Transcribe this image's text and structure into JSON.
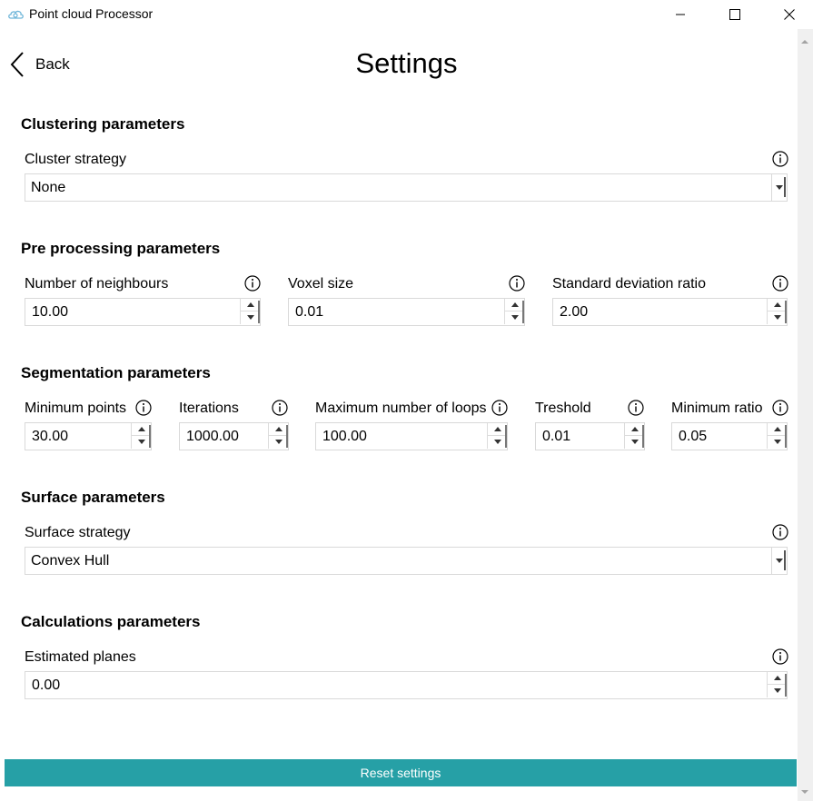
{
  "window": {
    "title": "Point cloud Processor",
    "icon": "cloud-icon"
  },
  "header": {
    "back_label": "Back",
    "page_title": "Settings"
  },
  "clustering": {
    "title": "Clustering parameters",
    "cluster_strategy_label": "Cluster strategy",
    "cluster_strategy_value": "None"
  },
  "preprocessing": {
    "title": "Pre processing parameters",
    "neighbours_label": "Number of neighbours",
    "neighbours_value": "10.00",
    "voxel_label": "Voxel size",
    "voxel_value": "0.01",
    "std_ratio_label": "Standard deviation ratio",
    "std_ratio_value": "2.00"
  },
  "segmentation": {
    "title": "Segmentation parameters",
    "min_points_label": "Minimum points",
    "min_points_value": "30.00",
    "iterations_label": "Iterations",
    "iterations_value": "1000.00",
    "max_loops_label": "Maximum number of loops",
    "max_loops_value": "100.00",
    "threshold_label": "Treshold",
    "threshold_value": "0.01",
    "min_ratio_label": "Minimum ratio",
    "min_ratio_value": "0.05"
  },
  "surface": {
    "title": "Surface parameters",
    "strategy_label": "Surface strategy",
    "strategy_value": "Convex Hull"
  },
  "calculations": {
    "title": "Calculations parameters",
    "planes_label": "Estimated planes",
    "planes_value": "0.00"
  },
  "footer": {
    "reset_label": "Reset settings"
  },
  "colors": {
    "accent": "#26a0a6",
    "border": "#d9d9d9"
  }
}
